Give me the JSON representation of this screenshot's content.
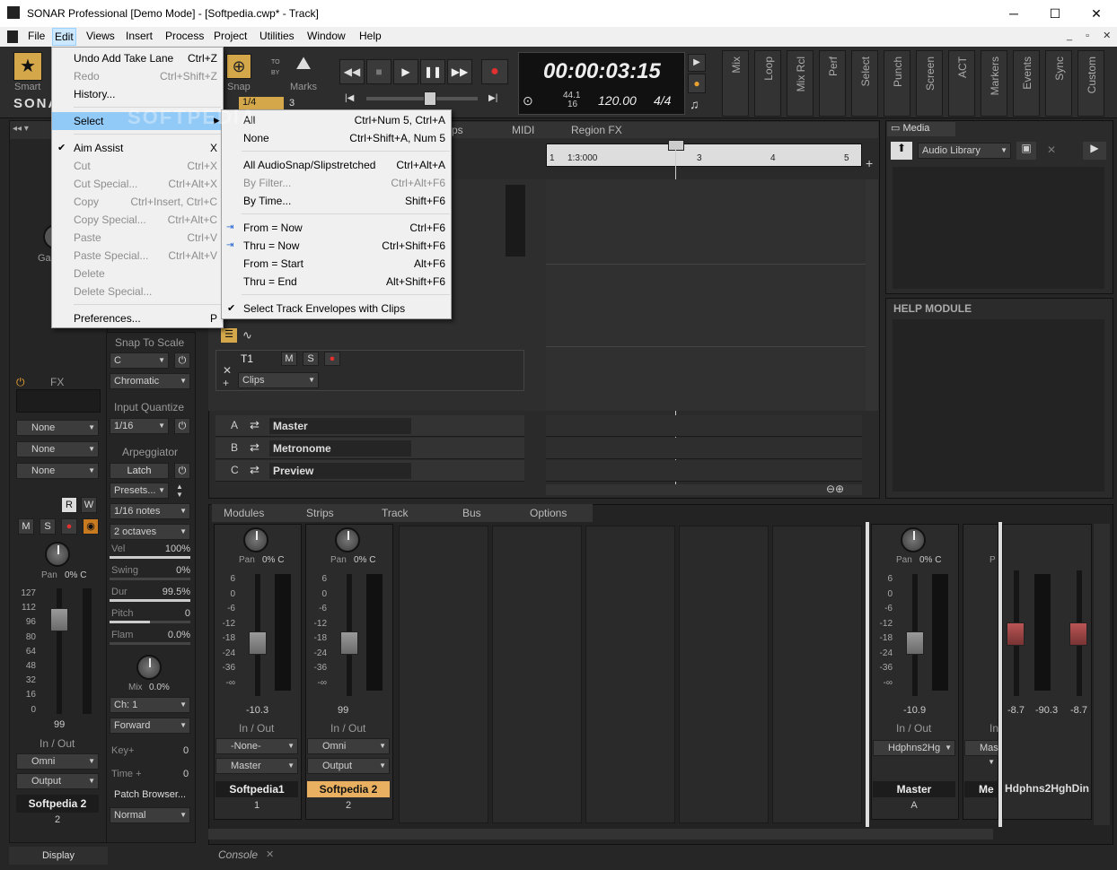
{
  "window": {
    "title": "SONAR Professional [Demo Mode] - [Softpedia.cwp* - Track]",
    "min": "─",
    "max": "☐",
    "close": "✕"
  },
  "menubar": [
    "File",
    "Edit",
    "Views",
    "Insert",
    "Process",
    "Project",
    "Utilities",
    "Window",
    "Help"
  ],
  "toolbar": {
    "smart_label": "Smart",
    "smart_extra": "S",
    "snap_label": "Snap",
    "marks_label": "Marks",
    "snap_value": "1/4",
    "snap_num": "3",
    "to_by": [
      "TO",
      "BY"
    ],
    "logo": "SONA",
    "time": "00:00:03:15",
    "rate_top": "44.1",
    "rate_bot": "16",
    "tempo": "120.00",
    "meter": "4/4",
    "modules": [
      "Mix",
      "Loop",
      "Mix Rcl",
      "Perf",
      "Select",
      "Punch",
      "Screen",
      "ACT",
      "Markers",
      "Events",
      "Sync",
      "Custom"
    ]
  },
  "edit_menu": [
    {
      "label": "Undo Add Take Lane",
      "shortcut": "Ctrl+Z",
      "enabled": true
    },
    {
      "label": "Redo",
      "shortcut": "Ctrl+Shift+Z",
      "enabled": false
    },
    {
      "label": "History...",
      "shortcut": "",
      "enabled": true
    },
    {
      "sep": true
    },
    {
      "label": "Select",
      "shortcut": "",
      "enabled": true,
      "highlight": true
    },
    {
      "sep": true
    },
    {
      "label": "Aim Assist",
      "shortcut": "X",
      "enabled": true,
      "check": true
    },
    {
      "label": "Cut",
      "shortcut": "Ctrl+X",
      "enabled": false
    },
    {
      "label": "Cut Special...",
      "shortcut": "Ctrl+Alt+X",
      "enabled": false
    },
    {
      "label": "Copy",
      "shortcut": "Ctrl+Insert, Ctrl+C",
      "enabled": false
    },
    {
      "label": "Copy Special...",
      "shortcut": "Ctrl+Alt+C",
      "enabled": false
    },
    {
      "label": "Paste",
      "shortcut": "Ctrl+V",
      "enabled": false
    },
    {
      "label": "Paste Special...",
      "shortcut": "Ctrl+Alt+V",
      "enabled": false
    },
    {
      "label": "Delete",
      "shortcut": "",
      "enabled": false
    },
    {
      "label": "Delete Special...",
      "shortcut": "",
      "enabled": false
    },
    {
      "sep": true
    },
    {
      "label": "Preferences...",
      "shortcut": "P",
      "enabled": true
    }
  ],
  "select_menu": [
    {
      "label": "All",
      "shortcut": "Ctrl+Num 5, Ctrl+A",
      "enabled": true
    },
    {
      "label": "None",
      "shortcut": "Ctrl+Shift+A, Num 5",
      "enabled": true
    },
    {
      "sep": true
    },
    {
      "label": "All AudioSnap/Slipstretched",
      "shortcut": "Ctrl+Alt+A",
      "enabled": true
    },
    {
      "label": "By Filter...",
      "shortcut": "Ctrl+Alt+F6",
      "enabled": false
    },
    {
      "label": "By Time...",
      "shortcut": "Shift+F6",
      "enabled": true
    },
    {
      "sep": true
    },
    {
      "label": "From = Now",
      "shortcut": "Ctrl+F6",
      "enabled": true,
      "icon": true
    },
    {
      "label": "Thru = Now",
      "shortcut": "Ctrl+Shift+F6",
      "enabled": true,
      "icon": true
    },
    {
      "label": "From = Start",
      "shortcut": "Alt+F6",
      "enabled": true
    },
    {
      "label": "Thru = End",
      "shortcut": "Alt+Shift+F6",
      "enabled": true
    },
    {
      "sep": true
    },
    {
      "label": "Select Track Envelopes with Clips",
      "shortcut": "",
      "enabled": true,
      "check": true
    }
  ],
  "watermark": "SOFTPEDIA",
  "track_tabs": [
    "ps",
    "MIDI",
    "Region FX"
  ],
  "ruler": [
    "1",
    "1:3:000",
    "3",
    "4",
    "5"
  ],
  "track": {
    "name": "T1",
    "m": "M",
    "s": "S",
    "clips": "Clips",
    "x": "✕",
    "plus": "+"
  },
  "buses": [
    {
      "letter": "A",
      "name": "Master"
    },
    {
      "letter": "B",
      "name": "Metronome"
    },
    {
      "letter": "C",
      "name": "Preview"
    }
  ],
  "inspector": {
    "ga": "Ga",
    "fx": "FX",
    "none": [
      "None",
      "None",
      "None"
    ],
    "r": "R",
    "w": "W",
    "m": "M",
    "s": "S",
    "pan": "Pan",
    "pan_val": "0% C",
    "scale": [
      "127",
      "112",
      "96",
      "80",
      "64",
      "48",
      "32",
      "16",
      "0"
    ],
    "fader_val": "99",
    "inout": "In / Out",
    "omni": "Omni",
    "output": "Output",
    "name": "Softpedia 2",
    "num": "2",
    "display": "Display"
  },
  "midi": {
    "snap_to_scale": "Snap To Scale",
    "key": "C",
    "scale": "Chromatic",
    "input_quantize": "Input Quantize",
    "iq_val": "1/16",
    "arpeggiator": "Arpeggiator",
    "latch": "Latch",
    "presets": "Presets...",
    "notes": "1/16 notes",
    "octaves": "2 octaves",
    "vel": "Vel",
    "vel_val": "100%",
    "swing": "Swing",
    "swing_val": "0%",
    "dur": "Dur",
    "dur_val": "99.5%",
    "pitch": "Pitch",
    "pitch_val": "0",
    "flam": "Flam",
    "flam_val": "0.0%",
    "mix": "Mix",
    "mix_val": "0.0%",
    "ch": "Ch: 1",
    "forward": "Forward",
    "key_plus": "Key+",
    "key_plus_val": "0",
    "time_plus": "Time +",
    "time_plus_val": "0",
    "patch": "Patch Browser...",
    "normal": "Normal"
  },
  "media": {
    "tab": "Media",
    "library": "Audio Library",
    "help": "HELP MODULE"
  },
  "console": {
    "tabs": [
      "Modules",
      "Strips",
      "Track",
      "Bus",
      "Options"
    ],
    "label": "Console",
    "strips": [
      {
        "pan": "Pan",
        "pan_val": "0% C",
        "val": "-10.3",
        "inout": "In / Out",
        "in": "-None-",
        "out": "Master",
        "name": "Softpedia1",
        "num": "1"
      },
      {
        "pan": "Pan",
        "pan_val": "0% C",
        "val": "99",
        "inout": "In / Out",
        "in": "Omni",
        "out": "Output",
        "name": "Softpedia 2",
        "num": "2"
      }
    ],
    "master": {
      "pan": "Pan",
      "pan_val": "0% C",
      "val": "-10.9",
      "inout": "In / Out",
      "out": "Hdphns2Hg",
      "name": "Master",
      "num": "A"
    },
    "partial": {
      "p": "P",
      "in": "In",
      "out": "Mas",
      "name": "Me"
    },
    "hp": {
      "v1": "-8.7",
      "v2": "-90.3",
      "v3": "-8.7",
      "name": "Hdphns2HghDin"
    },
    "db": [
      "6",
      "0",
      "-6",
      "-12",
      "-18",
      "-24",
      "-36",
      "-∞"
    ],
    "midscale": [
      "127",
      "112",
      "96",
      "80",
      "64",
      "48",
      "32",
      "16",
      "0"
    ]
  }
}
